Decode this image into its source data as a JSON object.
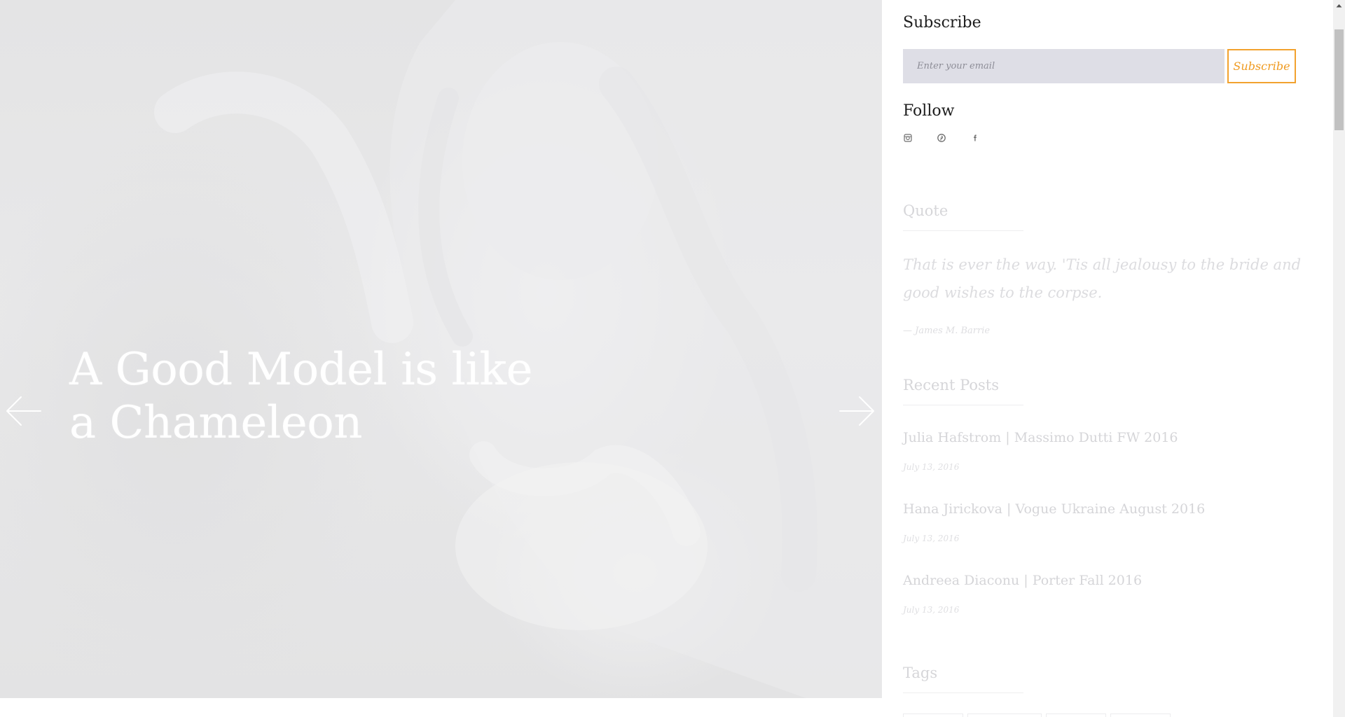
{
  "hero": {
    "title": "A Good Model is like a Chameleon",
    "prev_icon": "arrow-left-icon",
    "next_icon": "arrow-right-icon"
  },
  "sidebar": {
    "subscribe": {
      "title": "Subscribe",
      "email_placeholder": "Enter your email",
      "email_value": "",
      "button_label": "Subscribe",
      "accent_color": "#f2a22e"
    },
    "follow": {
      "title": "Follow",
      "icons": [
        "instagram-icon",
        "pinterest-icon",
        "facebook-icon"
      ]
    },
    "quote": {
      "title": "Quote",
      "text": "That is ever the way. 'Tis all jealousy to the bride and good wishes to the corpse.",
      "author": "— James M. Barrie"
    },
    "recent_posts": {
      "title": "Recent Posts",
      "items": [
        {
          "title": "Julia Hafstrom | Massimo Dutti FW 2016",
          "date": "July 13, 2016"
        },
        {
          "title": "Hana Jirickova | Vogue Ukraine August 2016",
          "date": "July 13, 2016"
        },
        {
          "title": "Andreea Diaconu | Porter Fall 2016",
          "date": "July 13, 2016"
        }
      ]
    },
    "tags": {
      "title": "Tags"
    }
  },
  "scrollbar": {
    "up_icon": "scroll-up-arrow-icon"
  }
}
